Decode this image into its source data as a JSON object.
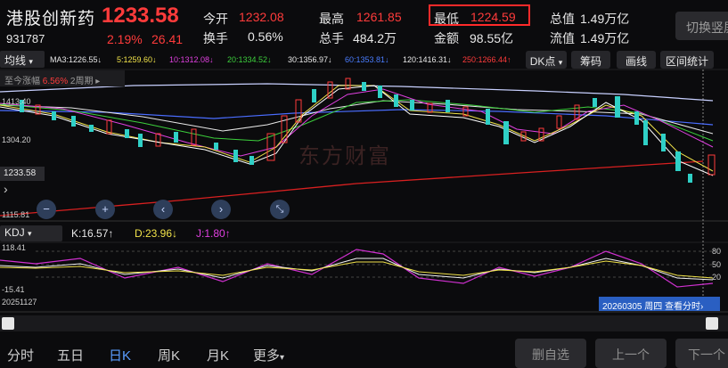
{
  "header": {
    "stock_name": "港股创新药",
    "price": "1233.58",
    "code": "931787",
    "change_pct": "2.19%",
    "change_amt": "26.41",
    "stats": [
      {
        "label": "今开",
        "value": "1232.08",
        "color": "red"
      },
      {
        "label": "换手",
        "value": "0.56%",
        "color": "white"
      },
      {
        "label": "最高",
        "value": "1261.85",
        "color": "red"
      },
      {
        "label": "总手",
        "value": "484.2万",
        "color": "white"
      },
      {
        "label": "最低",
        "value": "1224.59",
        "color": "red"
      },
      {
        "label": "金额",
        "value": "98.55亿",
        "color": "white"
      },
      {
        "label": "总值",
        "value": "1.49万亿",
        "color": "white"
      },
      {
        "label": "流值",
        "value": "1.49万亿",
        "color": "white"
      }
    ],
    "switch_label": "切换竖屏"
  },
  "toolbar": {
    "ma_dropdown": "均线",
    "ma_values": [
      {
        "label": "MA3:1226.55↓",
        "color": "#e8e8e8"
      },
      {
        "label": "5:1259.60↓",
        "color": "#f0e24a"
      },
      {
        "label": "10:1312.08↓",
        "color": "#e040e0"
      },
      {
        "label": "20:1334.52↓",
        "color": "#3ccf3c"
      },
      {
        "label": "30:1356.97↓",
        "color": "#e8e8e8"
      },
      {
        "label": "60:1353.81↓",
        "color": "#4a7dff"
      },
      {
        "label": "120:1416.31↓",
        "color": "#e8e8e8"
      },
      {
        "label": "250:1266.44↑",
        "color": "#ff3b3b"
      }
    ],
    "dk_label": "DK点",
    "chips_label": "筹码",
    "draw_label": "画线",
    "range_label": "区间统计"
  },
  "since_rise": {
    "label": "至今涨幅",
    "value": "6.56%",
    "period": "2周期 ▸"
  },
  "price_axis": {
    "top": "1413.40",
    "mid": "1304.20",
    "current": "1233.58",
    "bottom": "1115.81"
  },
  "watermark": "东方财富",
  "kdj": {
    "dropdown": "KDJ",
    "k": "K:16.57↑",
    "d": "D:23.96↓",
    "j": "J:1.80↑",
    "axis_top": "118.41",
    "axis_bottom": "-15.41",
    "levels": [
      "80",
      "50",
      "20"
    ]
  },
  "start_date": "20251127",
  "date_tag": "20260305 周四 查看分时›",
  "bottom_tabs": [
    "分时",
    "五日",
    "日K",
    "周K",
    "月K",
    "更多"
  ],
  "active_tab": "日K",
  "bottom_buttons": {
    "remove": "删自选",
    "prev": "上一个",
    "next": "下一个"
  },
  "chart_data": {
    "type": "candlestick",
    "ylim": [
      1115.81,
      1413.4
    ],
    "note_series": [
      "MA3",
      "MA5",
      "MA10",
      "MA20",
      "MA30",
      "MA60",
      "MA120",
      "MA250"
    ]
  }
}
